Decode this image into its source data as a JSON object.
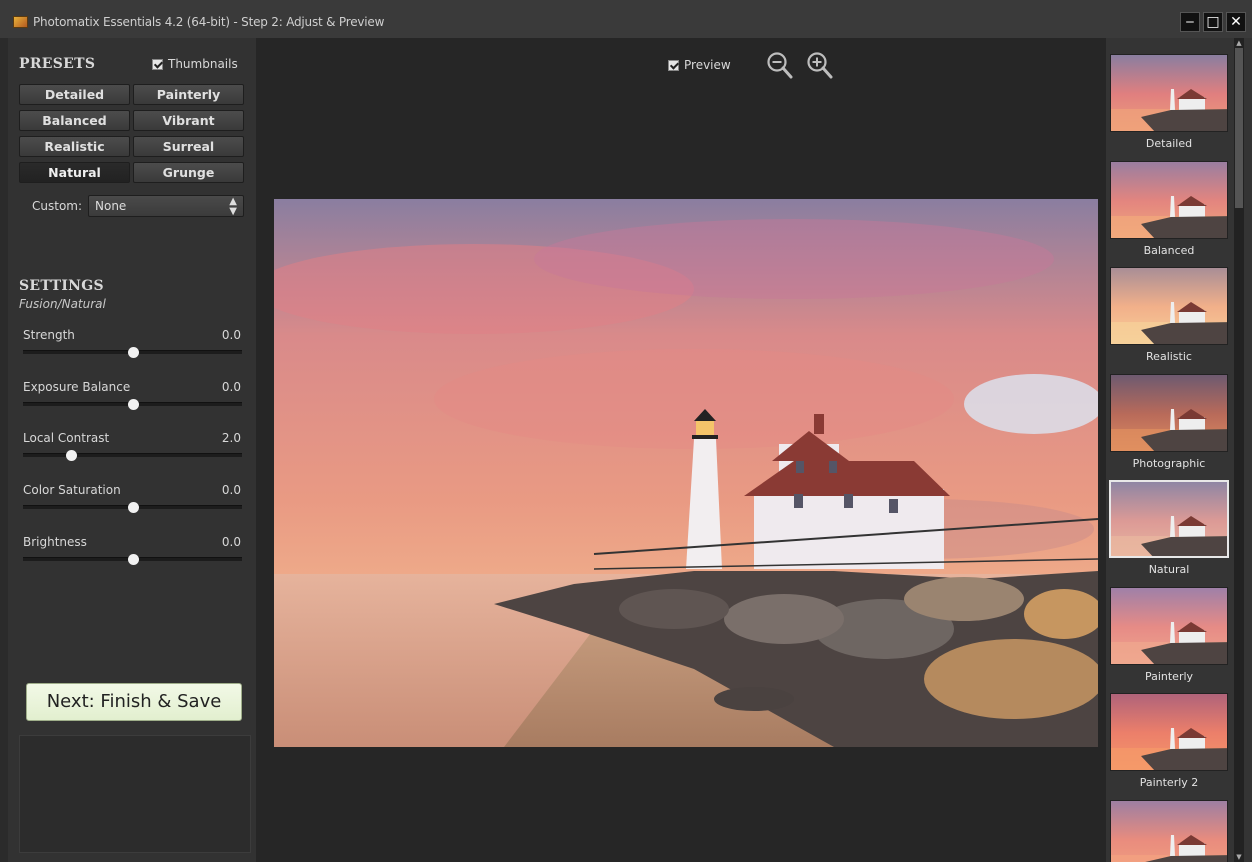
{
  "window": {
    "title": "Photomatix Essentials 4.2 (64-bit) - Step 2: Adjust & Preview",
    "minimize_glyph": "‒",
    "maximize_glyph": "□",
    "close_glyph": "✕"
  },
  "presets": {
    "heading": "PRESETS",
    "thumbnails_label": "Thumbnails",
    "thumbnails_checked": true,
    "buttons": [
      {
        "label": "Detailed"
      },
      {
        "label": "Painterly"
      },
      {
        "label": "Balanced"
      },
      {
        "label": "Vibrant"
      },
      {
        "label": "Realistic"
      },
      {
        "label": "Surreal"
      },
      {
        "label": "Natural",
        "active": true
      },
      {
        "label": "Grunge"
      }
    ],
    "custom_label": "Custom:",
    "custom_value": "None"
  },
  "settings": {
    "heading": "SETTINGS",
    "subtitle": "Fusion/Natural",
    "sliders": [
      {
        "label": "Strength",
        "value": "0.0",
        "fraction": 0.5
      },
      {
        "label": "Exposure Balance",
        "value": "0.0",
        "fraction": 0.5
      },
      {
        "label": "Local Contrast",
        "value": "2.0",
        "fraction": 0.22
      },
      {
        "label": "Color Saturation",
        "value": "0.0",
        "fraction": 0.5
      },
      {
        "label": "Brightness",
        "value": "0.0",
        "fraction": 0.5
      }
    ]
  },
  "next_button": "Next: Finish & Save",
  "preview": {
    "label": "Preview",
    "checked": true,
    "zoom_out_icon": "zoom-out-icon",
    "zoom_in_icon": "zoom-in-icon"
  },
  "thumbnails": [
    {
      "label": "Detailed"
    },
    {
      "label": "Balanced"
    },
    {
      "label": "Realistic"
    },
    {
      "label": "Photographic"
    },
    {
      "label": "Natural",
      "selected": true
    },
    {
      "label": "Painterly"
    },
    {
      "label": "Painterly 2"
    },
    {
      "label": ""
    }
  ],
  "colors": {
    "panel_bg": "#323232",
    "preview_bg": "#262626",
    "next_button_bg": "#eaf4dc"
  }
}
